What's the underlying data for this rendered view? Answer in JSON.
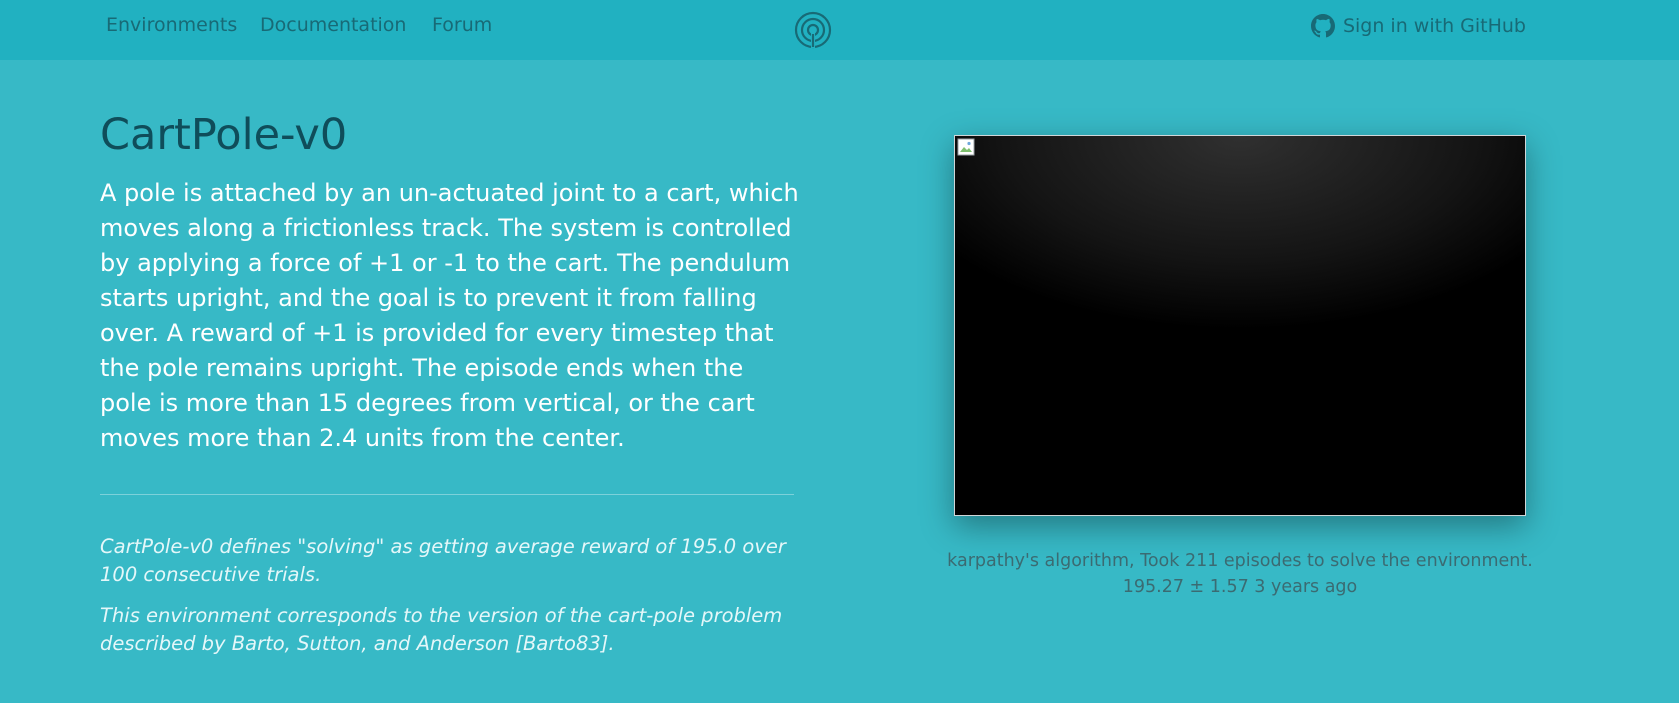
{
  "nav": {
    "links": [
      "Environments",
      "Documentation",
      "Forum"
    ],
    "signin_label": "Sign in with GitHub",
    "logo_icon": "openai-gym-logo-icon",
    "signin_icon": "github-icon"
  },
  "env": {
    "title": "CartPole-v0",
    "description": "A pole is attached by an un-actuated joint to a cart, which moves along a frictionless track. The system is controlled by applying a force of +1 or -1 to the cart. The pendulum starts upright, and the goal is to prevent it from falling over. A reward of +1 is provided for every timestep that the pole remains upright. The episode ends when the pole is more than 15 degrees from vertical, or the cart moves more than 2.4 units from the center.",
    "notes": [
      "CartPole-v0 defines \"solving\" as getting average reward of 195.0 over 100 consecutive trials.",
      "This environment corresponds to the version of the cart-pole problem described by Barto, Sutton, and Anderson [Barto83]."
    ]
  },
  "evaluation": {
    "caption_line1": "karpathy's algorithm, Took 211 episodes to solve the environment.",
    "caption_line2": "195.27 ± 1.57 3 years ago"
  },
  "colors": {
    "navbar_bg": "#21b1c1",
    "page_bg": "#37b9c6",
    "title": "#0f4d5a",
    "nav_text": "#186a76"
  }
}
